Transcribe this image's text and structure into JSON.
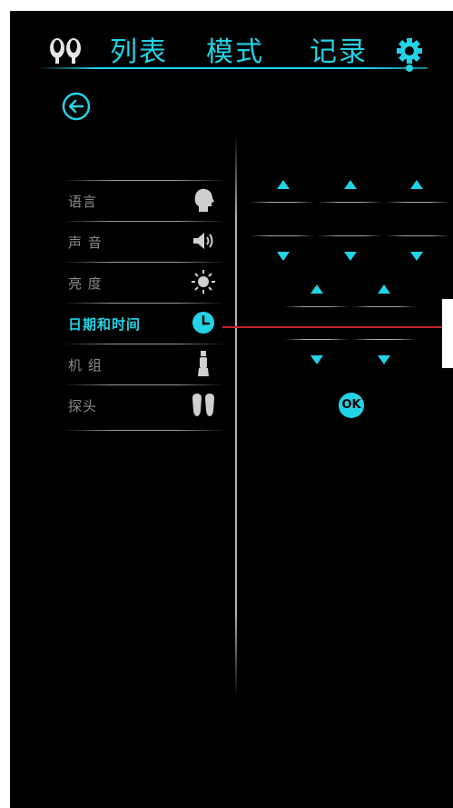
{
  "header": {
    "tabs": [
      {
        "label": "列表"
      },
      {
        "label": "模式"
      },
      {
        "label": "记录"
      }
    ],
    "accent_color": "#22d3e6"
  },
  "back_button": {
    "icon": "back-arrow-circle-icon"
  },
  "settings_menu": {
    "items": [
      {
        "label": "语言",
        "icon": "head-profile-icon",
        "active": false
      },
      {
        "label": "声 音",
        "icon": "speaker-icon",
        "active": false
      },
      {
        "label": "亮 度",
        "icon": "sun-icon",
        "active": false
      },
      {
        "label": "日期和时间",
        "icon": "clock-icon",
        "active": true
      },
      {
        "label": "机 组",
        "icon": "unit-device-icon",
        "active": false
      },
      {
        "label": "探头",
        "icon": "probe-icon",
        "active": false
      }
    ]
  },
  "datetime_editor": {
    "ok_label": "OK"
  }
}
